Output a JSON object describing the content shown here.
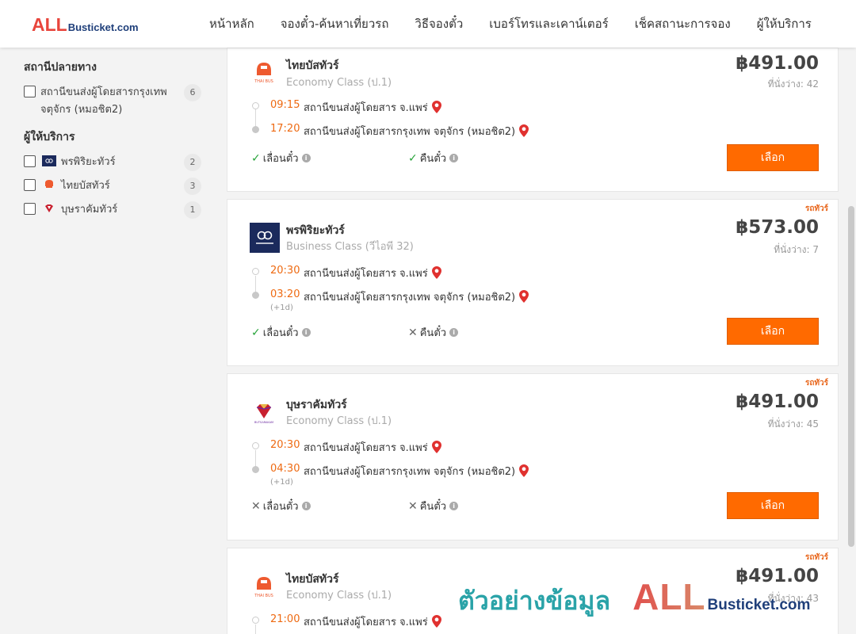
{
  "header": {
    "logo_all": "ALL",
    "logo_rest": "Busticket.com",
    "nav": [
      "หน้าหลัก",
      "จองตั๋ว-ค้นหาเที่ยวรถ",
      "วิธีจองตั๋ว",
      "เบอร์โทรและเคาน์เตอร์",
      "เช็คสถานะการจอง",
      "ผู้ให้บริการ"
    ]
  },
  "sidebar": {
    "destination_title": "สถานีปลายทาง",
    "destinations": [
      {
        "label": "สถานีขนส่งผู้โดยสารกรุงเทพ จตุจักร (หมอชิต2)",
        "count": "6"
      }
    ],
    "operator_title": "ผู้ให้บริการ",
    "operators": [
      {
        "label": "พรพิริยะทัวร์",
        "count": "2",
        "logo": "pornpiriya-logo"
      },
      {
        "label": "ไทยบัสทัวร์",
        "count": "3",
        "logo": "thaibus-logo"
      },
      {
        "label": "บุษราคัมทัวร์",
        "count": "1",
        "logo": "butsarakam-logo"
      }
    ]
  },
  "trips": [
    {
      "tag": "",
      "operator": "ไทยบัสทัวร์",
      "bus_class": "Economy Class (ป.1)",
      "price": "฿491.00",
      "seats": "ที่นั่งว่าง: 42",
      "depart_time": "09:15",
      "depart_place": "สถานีขนส่งผู้โดยสาร จ.แพร่",
      "arrive_time": "17:20",
      "arrive_place": "สถานีขนส่งผู้โดยสารกรุงเทพ จตุจักร (หมอชิต2)",
      "next_day": "",
      "change_label": "เลื่อนตั๋ว",
      "change_ok": true,
      "refund_label": "คืนตั๋ว",
      "refund_ok": true,
      "button": "เลือก",
      "logo": "thaibus-logo"
    },
    {
      "tag": "รถทัวร์",
      "operator": "พรพิริยะทัวร์",
      "bus_class": "Business Class (วีไอพี 32)",
      "price": "฿573.00",
      "seats": "ที่นั่งว่าง: 7",
      "depart_time": "20:30",
      "depart_place": "สถานีขนส่งผู้โดยสาร จ.แพร่",
      "arrive_time": "03:20",
      "arrive_place": "สถานีขนส่งผู้โดยสารกรุงเทพ จตุจักร (หมอชิต2)",
      "next_day": "(+1d)",
      "change_label": "เลื่อนตั๋ว",
      "change_ok": true,
      "refund_label": "คืนตั๋ว",
      "refund_ok": false,
      "button": "เลือก",
      "logo": "pornpiriya-logo"
    },
    {
      "tag": "รถทัวร์",
      "operator": "บุษราคัมทัวร์",
      "bus_class": "Economy Class (ป.1)",
      "price": "฿491.00",
      "seats": "ที่นั่งว่าง: 45",
      "depart_time": "20:30",
      "depart_place": "สถานีขนส่งผู้โดยสาร จ.แพร่",
      "arrive_time": "04:30",
      "arrive_place": "สถานีขนส่งผู้โดยสารกรุงเทพ จตุจักร (หมอชิต2)",
      "next_day": "(+1d)",
      "change_label": "เลื่อนตั๋ว",
      "change_ok": false,
      "refund_label": "คืนตั๋ว",
      "refund_ok": false,
      "button": "เลือก",
      "logo": "butsarakam-logo"
    },
    {
      "tag": "รถทัวร์",
      "operator": "ไทยบัสทัวร์",
      "bus_class": "Economy Class (ป.1)",
      "price": "฿491.00",
      "seats": "ที่นั่งว่าง: 43",
      "depart_time": "21:00",
      "depart_place": "สถานีขนส่งผู้โดยสาร จ.แพร่",
      "logo": "thaibus-logo"
    }
  ],
  "watermark": {
    "text": "ตัวอย่างข้อมูล",
    "all": "ALL",
    "rest": "Busticket.com"
  },
  "colors": {
    "accent_orange": "#ff6a00",
    "time_orange": "#ee6a12",
    "brand_red": "#e8453c",
    "brand_navy": "#1f3f7a",
    "check_green": "#27a43a",
    "watermark_teal": "#2aa3a8"
  }
}
